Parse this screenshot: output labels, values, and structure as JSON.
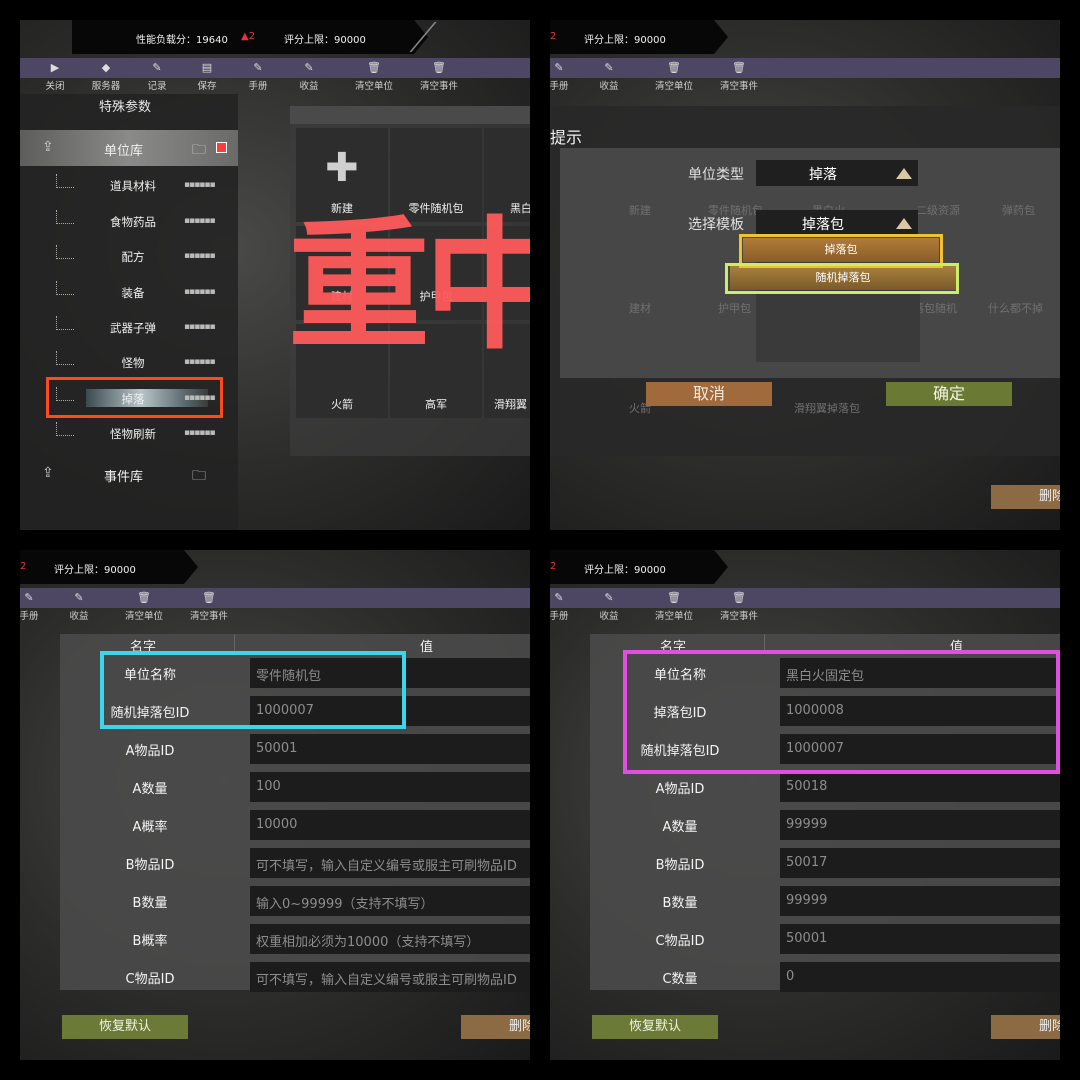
{
  "status": {
    "perf_label": "性能负载分：19640",
    "perf_delta": "▲2",
    "score_cap": "评分上限：90000",
    "clipped_delta": "2"
  },
  "toolbar": {
    "close": "关闭",
    "server": "服务器",
    "record": "记录",
    "save": "保存",
    "manual": "手册",
    "income": "收益",
    "clear_units": "清空单位",
    "clear_events": "清空事件"
  },
  "sidebar": {
    "title": "特殊参数",
    "unit_lib": "单位库",
    "event_lib": "事件库",
    "categories": [
      "道具材料",
      "食物药品",
      "配方",
      "装备",
      "武器子弹",
      "怪物",
      "掉落",
      "怪物刷新"
    ],
    "grip": "▪▪▪▪▪▪"
  },
  "grid": {
    "new": "新建",
    "c2": "零件随机包",
    "c3": "黑白",
    "c4": "建材",
    "c5": "护甲包",
    "c7": "火箭",
    "c8": "高军",
    "c9": "滑翔翼",
    "overlay": "重中"
  },
  "dialog": {
    "title": "提示",
    "unit_type_label": "单位类型",
    "unit_type_value": "掉落",
    "template_label": "选择模板",
    "template_value": "掉落包",
    "options": [
      "掉落包",
      "随机掉落包"
    ],
    "cancel": "取消",
    "ok": "确定",
    "ghost": [
      "新建",
      "零件随机包",
      "黑白火",
      "二级资源",
      "弹药包",
      "建材",
      "护甲包",
      "二级掉落包随机",
      "什么都不掉",
      "火箭",
      "滑翔翼掉落包"
    ]
  },
  "actions": {
    "delete": "删除",
    "restore": "恢复默认"
  },
  "table_headers": {
    "name": "名字",
    "value": "值"
  },
  "table_left": [
    {
      "k": "单位名称",
      "v": "零件随机包"
    },
    {
      "k": "随机掉落包ID",
      "v": "1000007"
    },
    {
      "k": "A物品ID",
      "v": "50001"
    },
    {
      "k": "A数量",
      "v": "100"
    },
    {
      "k": "A概率",
      "v": "10000"
    },
    {
      "k": "B物品ID",
      "v": "可不填写，输入自定义编号或服主可刷物品ID"
    },
    {
      "k": "B数量",
      "v": "输入0~99999（支持不填写）"
    },
    {
      "k": "B概率",
      "v": "权重相加必须为10000（支持不填写）"
    },
    {
      "k": "C物品ID",
      "v": "可不填写，输入自定义编号或服主可刷物品ID"
    }
  ],
  "table_right": [
    {
      "k": "单位名称",
      "v": "黑白火固定包"
    },
    {
      "k": "掉落包ID",
      "v": "1000008"
    },
    {
      "k": "随机掉落包ID",
      "v": "1000007"
    },
    {
      "k": "A物品ID",
      "v": "50018"
    },
    {
      "k": "A数量",
      "v": "99999"
    },
    {
      "k": "B物品ID",
      "v": "50017"
    },
    {
      "k": "B数量",
      "v": "99999"
    },
    {
      "k": "C物品ID",
      "v": "50001"
    },
    {
      "k": "C数量",
      "v": "0"
    }
  ],
  "colors": {
    "highlight_orange": "#ff4a1f",
    "highlight_yellow": "#f2c033",
    "highlight_lime": "#c9ef6a",
    "highlight_cyan": "#3ad7ec",
    "highlight_magenta": "#e24ee0",
    "overlay_text": "#ff5a5a",
    "toolbar": "#4d4763"
  },
  "icons": {
    "close": "play-icon",
    "server": "cube-icon",
    "record": "edit-icon",
    "save": "document-icon",
    "manual": "edit-icon",
    "income": "edit-icon",
    "clear_units": "trash-icon",
    "clear_events": "trash-icon",
    "unit_lib": "upload-icon",
    "add_folder": "folder-add-icon"
  }
}
